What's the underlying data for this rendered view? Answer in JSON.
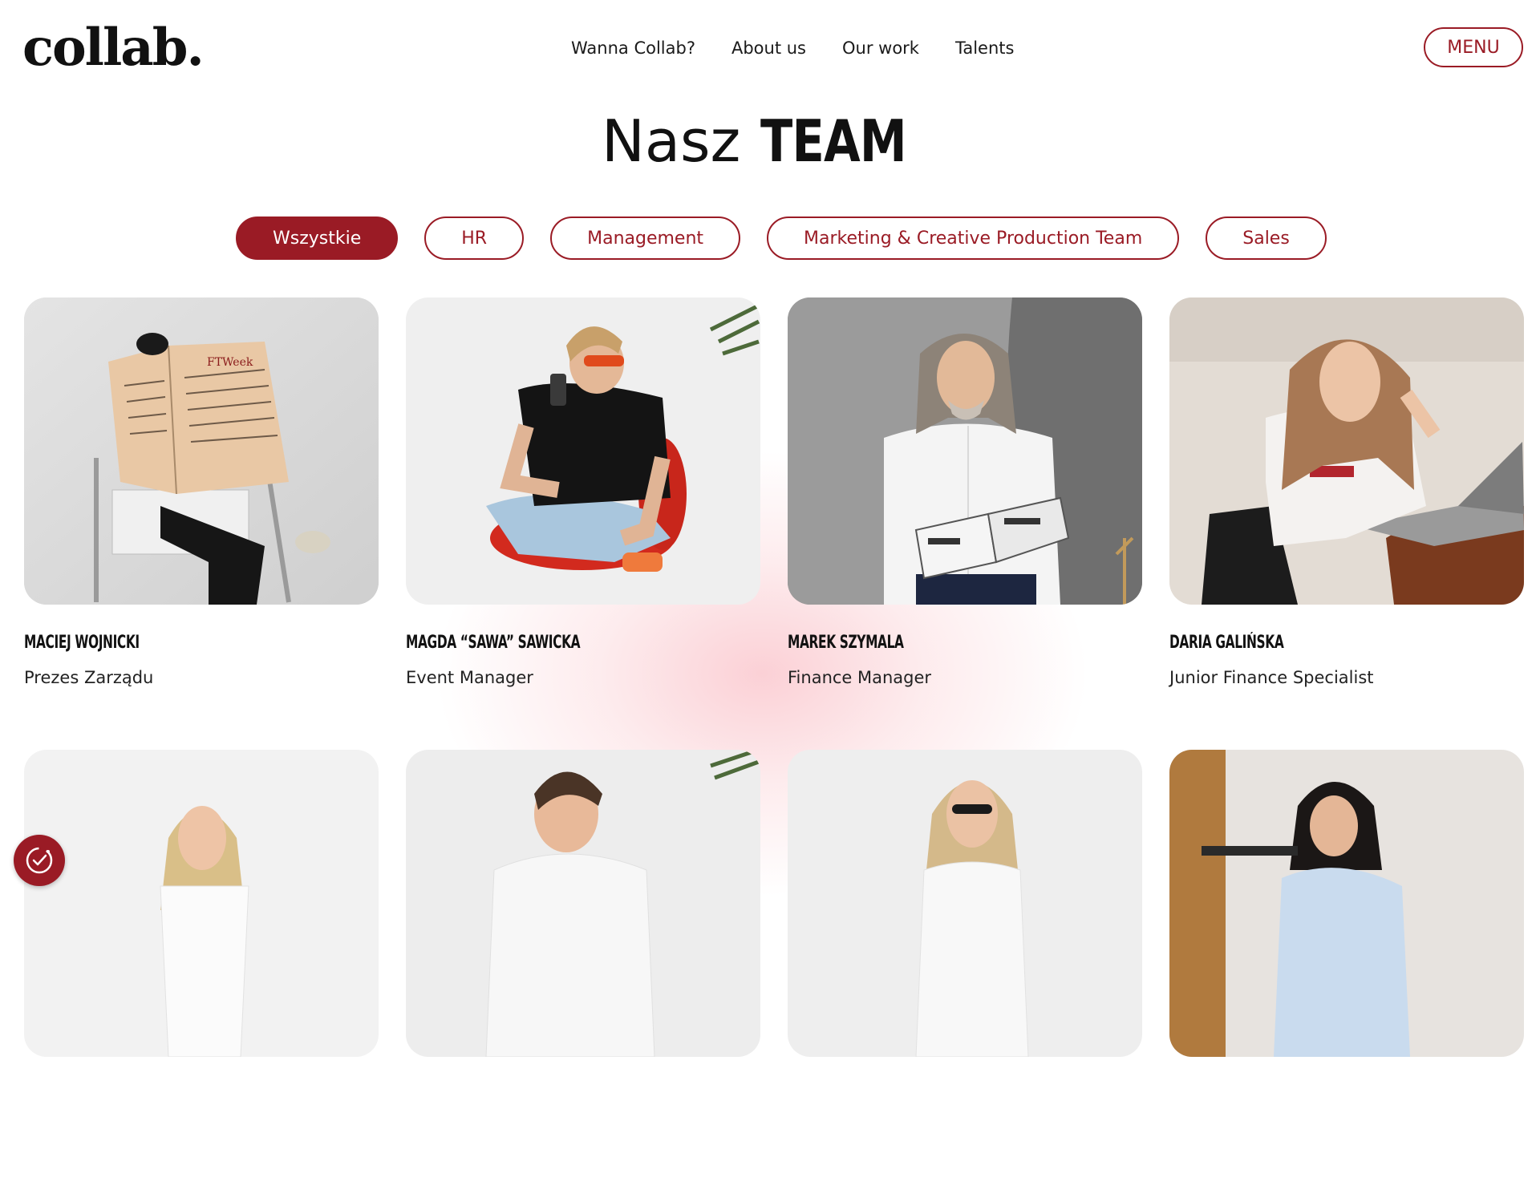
{
  "header": {
    "logo": "collab.",
    "nav": [
      "Wanna Collab?",
      "About us",
      "Our work",
      "Talents"
    ],
    "menu_label": "MENU"
  },
  "hero": {
    "title_light": "Nasz",
    "title_bold": "TEAM"
  },
  "filters": {
    "items": [
      "Wszystkie",
      "HR",
      "Management",
      "Marketing & Creative Production Team",
      "Sales"
    ],
    "active": "Wszystkie"
  },
  "team": [
    {
      "name": "MACIEJ WOJNICKI",
      "role": "Prezes Zarządu"
    },
    {
      "name": "MAGDA “SAWA” SAWICKA",
      "role": "Event Manager"
    },
    {
      "name": "MAREK SZYMALA",
      "role": "Finance Manager"
    },
    {
      "name": "DARIA GALIŃSKA",
      "role": "Junior Finance Specialist"
    },
    {
      "name": "",
      "role": ""
    },
    {
      "name": "",
      "role": ""
    },
    {
      "name": "",
      "role": ""
    },
    {
      "name": "",
      "role": ""
    }
  ],
  "colors": {
    "accent": "#9a1b25",
    "text": "#111111",
    "background": "#ffffff"
  },
  "icons": {
    "cookie_badge": "cookie-consent-icon"
  }
}
